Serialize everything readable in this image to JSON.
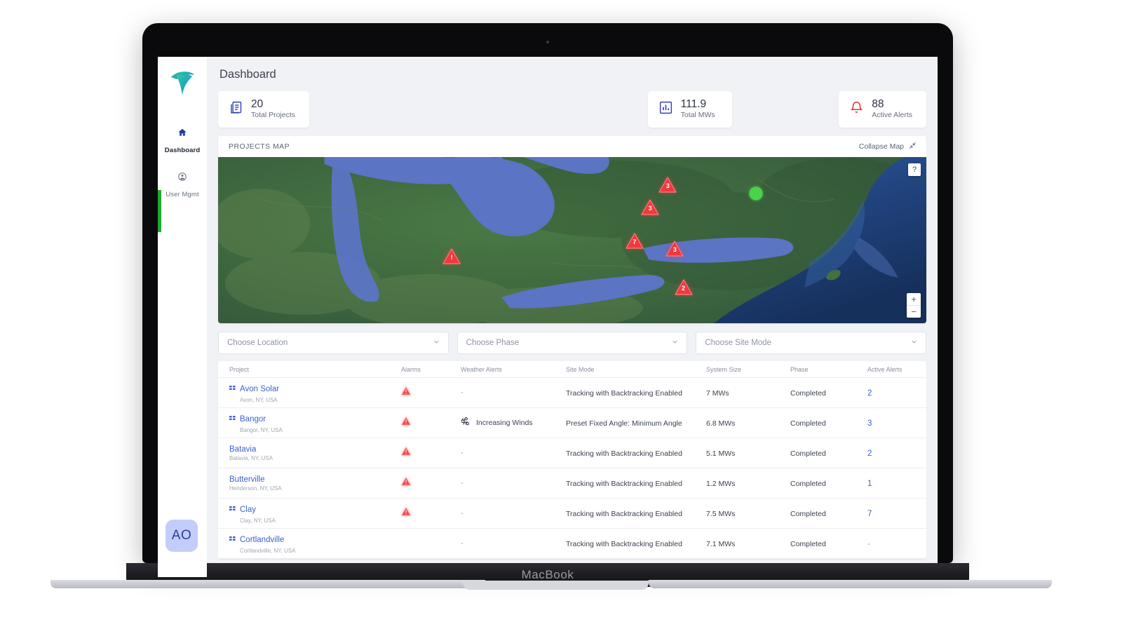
{
  "device": {
    "label": "MacBook"
  },
  "sidebar": {
    "logo_alt": "company-logo",
    "items": [
      {
        "label": "Dashboard",
        "icon": "home-icon",
        "active": true
      },
      {
        "label": "User Mgmt",
        "icon": "user-icon",
        "active": false
      }
    ],
    "avatar_initials": "AO"
  },
  "header": {
    "title": "Dashboard"
  },
  "kpis": [
    {
      "value": "20",
      "caption": "Total Projects",
      "icon": "documents-icon",
      "color": "#3340b5"
    },
    {
      "value": "111.9",
      "caption": "Total MWs",
      "icon": "bar-chart-icon",
      "color": "#3340b5"
    },
    {
      "value": "88",
      "caption": "Active Alerts",
      "icon": "bell-icon",
      "color": "#e03131"
    }
  ],
  "map_panel": {
    "title": "PROJECTS MAP",
    "collapse_label": "Collapse Map",
    "help_label": "?",
    "zoom_in_label": "+",
    "zoom_out_label": "−",
    "markers": [
      {
        "type": "alert-triangle",
        "label": "!",
        "x": 33.0,
        "y": 59.5
      },
      {
        "type": "alert-triangle",
        "label": "3",
        "x": 63.5,
        "y": 16.5
      },
      {
        "type": "alert-triangle",
        "label": "3",
        "x": 61.0,
        "y": 30.0
      },
      {
        "type": "alert-triangle",
        "label": "7",
        "x": 58.8,
        "y": 50.0
      },
      {
        "type": "alert-triangle",
        "label": "3",
        "x": 64.5,
        "y": 55.0
      },
      {
        "type": "alert-triangle",
        "label": "2",
        "x": 65.7,
        "y": 78.0
      },
      {
        "type": "status-ok-dot",
        "label": "",
        "x": 75.9,
        "y": 22.0
      }
    ]
  },
  "filters": [
    {
      "placeholder": "Choose Location",
      "value": ""
    },
    {
      "placeholder": "Choose Phase",
      "value": ""
    },
    {
      "placeholder": "Choose Site Mode",
      "value": ""
    }
  ],
  "table": {
    "columns": [
      "Project",
      "Alarms",
      "Weather Alerts",
      "Site Mode",
      "System Size",
      "Phase",
      "Active Alerts"
    ],
    "rows": [
      {
        "project": "Avon Solar",
        "location": "Avon, NY, USA",
        "has_grid_icon": true,
        "alarm": "triangle",
        "weather": "-",
        "weather_icon": "",
        "mode": "Tracking with Backtracking Enabled",
        "size": "7 MWs",
        "phase": "Completed",
        "alerts": "2"
      },
      {
        "project": "Bangor",
        "location": "Bangor, NY, USA",
        "has_grid_icon": true,
        "alarm": "triangle",
        "weather": "Increasing Winds",
        "weather_icon": "wind-icon",
        "mode": "Preset Fixed Angle: Minimum Angle",
        "size": "6.8 MWs",
        "phase": "Completed",
        "alerts": "3"
      },
      {
        "project": "Batavia",
        "location": "Batavia, NY, USA",
        "has_grid_icon": false,
        "alarm": "triangle",
        "weather": "-",
        "weather_icon": "",
        "mode": "Tracking with Backtracking Enabled",
        "size": "5.1 MWs",
        "phase": "Completed",
        "alerts": "2"
      },
      {
        "project": "Butterville",
        "location": "Henderson, NY, USA",
        "has_grid_icon": false,
        "alarm": "triangle",
        "weather": "-",
        "weather_icon": "",
        "mode": "Tracking with Backtracking Enabled",
        "size": "1.2 MWs",
        "phase": "Completed",
        "alerts": "1"
      },
      {
        "project": "Clay",
        "location": "Clay, NY, USA",
        "has_grid_icon": true,
        "alarm": "triangle",
        "weather": "-",
        "weather_icon": "",
        "mode": "Tracking with Backtracking Enabled",
        "size": "7.5 MWs",
        "phase": "Completed",
        "alerts": "7"
      },
      {
        "project": "Cortlandville",
        "location": "Cortlandville, NY, USA",
        "has_grid_icon": true,
        "alarm": "dot",
        "weather": "-",
        "weather_icon": "",
        "mode": "Tracking with Backtracking Enabled",
        "size": "7.1 MWs",
        "phase": "Completed",
        "alerts": "-"
      }
    ]
  },
  "colors": {
    "accent_blue": "#3c5fd0",
    "alert_red": "#e8363d",
    "ok_green": "#2fc12f",
    "page_bg": "#f1f2f5"
  }
}
